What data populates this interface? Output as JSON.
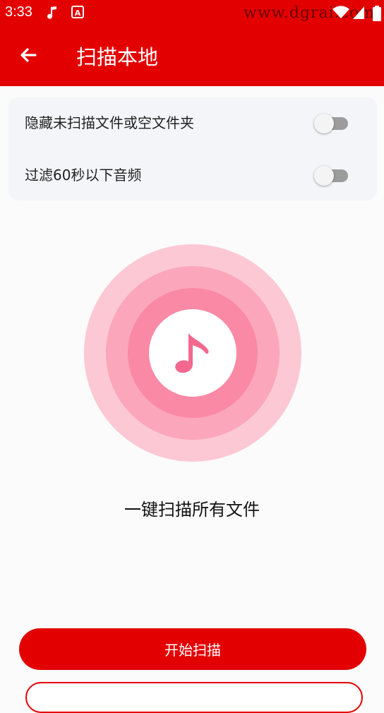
{
  "status_bar": {
    "time": "3:33",
    "watermark": "www.dgrai.com",
    "icons": [
      "music-note-icon",
      "app-a-icon",
      "wifi-icon",
      "signal-icon",
      "battery-icon"
    ]
  },
  "header": {
    "title": "扫描本地",
    "back_icon": "arrow-left-icon",
    "background": "#e30000"
  },
  "settings": {
    "items": [
      {
        "label": "隐藏未扫描文件或空文件夹",
        "enabled": false
      },
      {
        "label": "过滤60秒以下音频",
        "enabled": false
      }
    ]
  },
  "scan": {
    "icon": "music-note-icon",
    "label": "一键扫描所有文件",
    "ring_colors": [
      "#fcc8d4",
      "#fba6bb",
      "#fa89a5"
    ],
    "icon_color": "#f4688f"
  },
  "actions": {
    "start_label": "开始扫描",
    "accent": "#e30000"
  }
}
